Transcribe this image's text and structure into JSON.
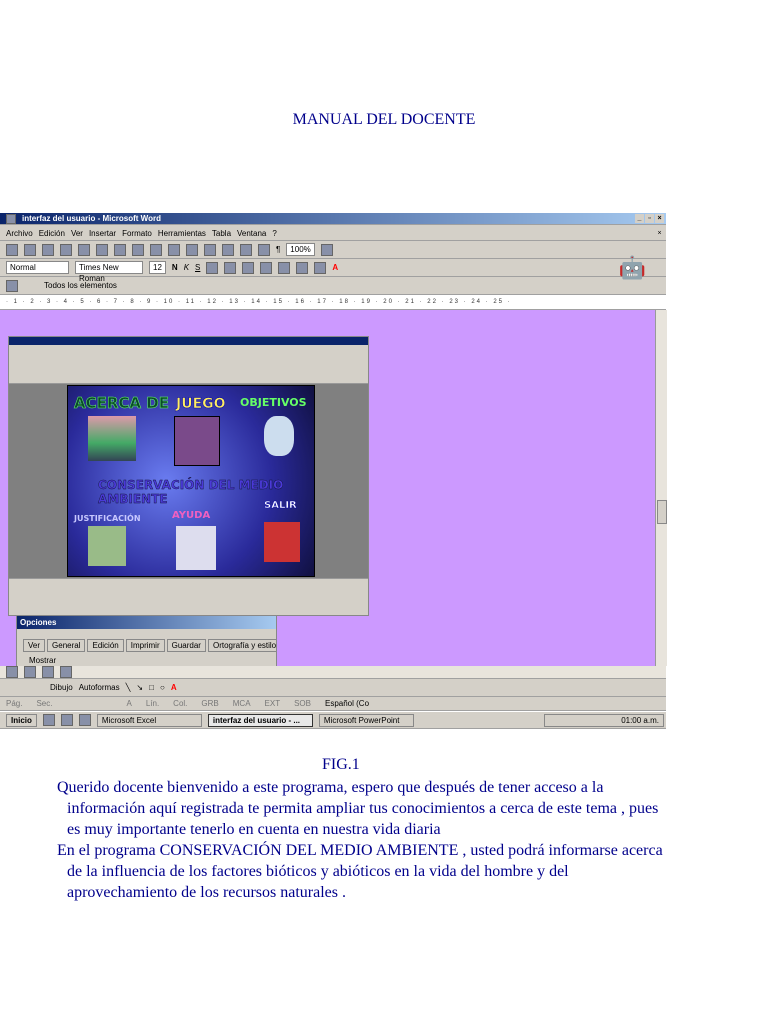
{
  "title": "MANUAL DEL DOCENTE",
  "word": {
    "window_title": "interfaz del usuario - Microsoft Word",
    "menu": [
      "Archivo",
      "Edición",
      "Ver",
      "Insertar",
      "Formato",
      "Herramientas",
      "Tabla",
      "Ventana",
      "?"
    ],
    "zoom": "100%",
    "style": "Normal",
    "font": "Times New Roman",
    "size": "12",
    "toolbar3_label": "Todos los elementos",
    "ruler": "· 1 · 2 · 3 · 4 · 5 · 6 · 7 · 8 · 9 · 10 · 11 · 12 · 13 · 14 · 15 · 16 · 17 · 18 · 19 · 20 · 21 · 22 · 23 · 24 · 25 ·",
    "draw_label": "Dibujo",
    "autoshapes_label": "Autoformas",
    "status": [
      "Pág.",
      "Sec.",
      "A",
      "Lín.",
      "Col.",
      "GRB",
      "MCA",
      "EXT",
      "SOB",
      "Español (Co"
    ]
  },
  "ppt": {
    "slide": {
      "about": "ACERCA DE",
      "game": "JUEGO",
      "objectives": "OBJETIVOS",
      "main": "CONSERVACIÓN DEL MEDIO AMBIENTE",
      "exit": "SALIR",
      "justification": "JUSTIFICACIÓN",
      "help": "AYUDA"
    }
  },
  "options_dialog": {
    "title": "Opciones",
    "tabs": [
      "Ver",
      "General",
      "Edición",
      "Imprimir",
      "Guardar",
      "Ortografía y estilo"
    ],
    "group": "Mostrar"
  },
  "taskbar": {
    "start": "Inicio",
    "items": [
      "Microsoft Excel",
      "interfaz del usuario - ...",
      "Microsoft PowerPoint"
    ],
    "clock": "01:00 a.m."
  },
  "caption": "FIG.1",
  "paragraphs": [
    [
      "Querido docente bienvenido a este programa,  espero que después de tener acceso a la",
      "información aquí registrada  te permita ampliar tus conocimientos a cerca de este tema , pues",
      "es muy importante  tenerlo en cuenta en nuestra vida diaria"
    ],
    [
      "En el programa CONSERVACIÓN DEL MEDIO AMBIENTE , usted podrá informarse acerca",
      "de la influencia de los factores bióticos y abióticos en la vida del hombre y del",
      "aprovechamiento de los recursos naturales ."
    ]
  ]
}
